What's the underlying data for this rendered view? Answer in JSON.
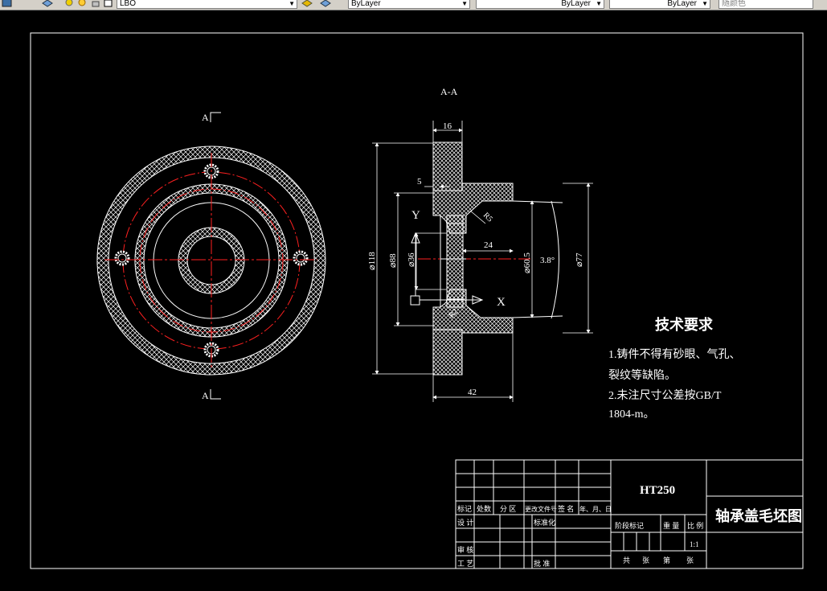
{
  "toolbar": {
    "layer_field": "LBO",
    "color_field": "ByLayer",
    "linetype_field": "ByLayer",
    "lineweight_field": "ByLayer",
    "plot_style_field": "随颜色"
  },
  "drawing": {
    "section_label": "A-A",
    "cut_marker_top": "A",
    "cut_marker_bottom": "A",
    "dimensions": {
      "top_width": "16",
      "step": "5",
      "dia_118": "⌀118",
      "dia_88": "⌀88",
      "dia_36": "⌀36",
      "length_24": "24",
      "dia_60_5": "⌀60.5",
      "angle": "3.8°",
      "dia_77": "⌀77",
      "radius_r5": "R5",
      "radius_r2": "R2",
      "total_length": "42",
      "axis_y": "Y",
      "axis_x": "X"
    },
    "tech_req": {
      "title": "技术要求",
      "line1": "1.铸件不得有砂眼、气孔、",
      "line2": "裂纹等缺陷。",
      "line3": "2.未注尺寸公差按GB/T",
      "line4": "1804-m。"
    },
    "title_block": {
      "material": "HT250",
      "part_name": "轴承盖毛坯图",
      "scale": "1:1",
      "h_mark": "标记",
      "h_count": "处数",
      "h_zone": "分 区",
      "h_doc": "更改文件号",
      "h_sign": "签 名",
      "h_date": "年、月、日",
      "designer": "设 计",
      "standardize": "标准化",
      "review": "审 核",
      "process": "工 艺",
      "approve": "批 准",
      "stage_mark": "阶段标记",
      "weight": "重 量",
      "ratio": "比 例",
      "total_sheets": "共",
      "sheets_unit": "张",
      "sheet_no": "第",
      "sheet_unit": "张"
    }
  },
  "colors": {
    "line": "#ffffff",
    "center": "#ff2020",
    "background": "#000000"
  }
}
